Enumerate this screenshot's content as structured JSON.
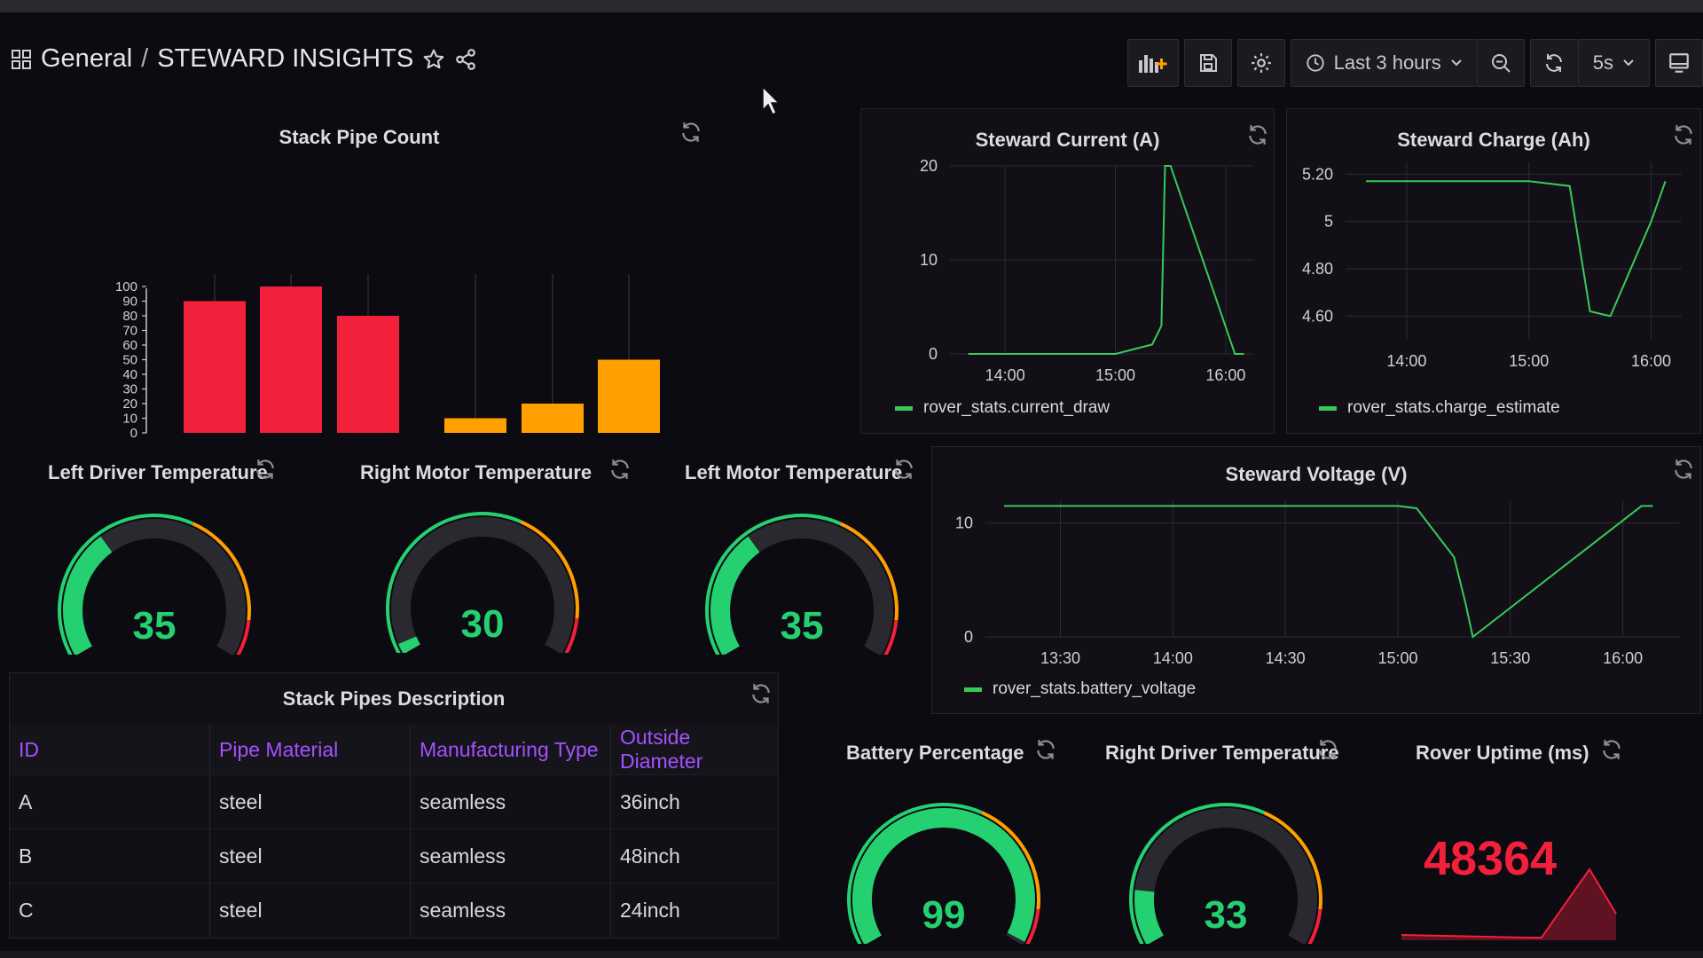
{
  "header": {
    "breadcrumb_root": "General",
    "breadcrumb_sep": "/",
    "dashboard_title": "STEWARD INSIGHTS",
    "time_range": "Last 3 hours",
    "refresh_interval": "5s"
  },
  "panels": {
    "stack_pipe_count": {
      "title": "Stack Pipe Count"
    },
    "steward_current": {
      "title": "Steward Current (A)",
      "legend": "rover_stats.current_draw"
    },
    "steward_charge": {
      "title": "Steward Charge (Ah)",
      "legend": "rover_stats.charge_estimate"
    },
    "steward_voltage": {
      "title": "Steward Voltage (V)",
      "legend": "rover_stats.battery_voltage"
    },
    "left_driver_temp": {
      "title": "Left Driver Temperature",
      "value": "35"
    },
    "right_motor_temp": {
      "title": "Right Motor Temperature",
      "value": "30"
    },
    "left_motor_temp": {
      "title": "Left Motor Temperature",
      "value": "35"
    },
    "battery_percentage": {
      "title": "Battery Percentage",
      "value": "99"
    },
    "right_driver_temp": {
      "title": "Right Driver Temperature",
      "value": "33"
    },
    "rover_uptime": {
      "title": "Rover Uptime (ms)",
      "value": "48364"
    },
    "stack_pipes_description": {
      "title": "Stack Pipes Description",
      "columns": [
        "ID",
        "Pipe Material",
        "Manufacturing Type",
        "Outside Diameter"
      ],
      "rows": [
        [
          "A",
          "steel",
          "seamless",
          "36inch"
        ],
        [
          "B",
          "steel",
          "seamless",
          "48inch"
        ],
        [
          "C",
          "steel",
          "seamless",
          "24inch"
        ]
      ]
    }
  },
  "colors": {
    "green": "#25d070",
    "red": "#f2203a",
    "orange": "#ff9f00",
    "purple": "#a352ff",
    "series_green": "#37c95a"
  },
  "chart_data": [
    {
      "type": "bar",
      "title": "Stack Pipe Count",
      "categories": [
        "",
        "",
        "",
        "",
        "",
        ""
      ],
      "values": [
        90,
        100,
        80,
        10,
        20,
        50
      ],
      "bar_colors": [
        "#f2203a",
        "#f2203a",
        "#f2203a",
        "#ff9f00",
        "#ff9f00",
        "#ff9f00"
      ],
      "ylim": [
        0,
        100
      ],
      "yticks": [
        0,
        10,
        20,
        30,
        40,
        50,
        60,
        70,
        80,
        90,
        100
      ]
    },
    {
      "type": "line",
      "title": "Steward Current (A)",
      "series": [
        {
          "name": "rover_stats.current_draw",
          "x": [
            "13:40",
            "14:30",
            "15:00",
            "15:20",
            "15:25",
            "15:27",
            "15:30",
            "16:05",
            "16:10"
          ],
          "values": [
            0,
            0,
            0,
            1,
            3,
            20,
            20,
            0,
            0
          ]
        }
      ],
      "xticks": [
        "14:00",
        "15:00",
        "16:00"
      ],
      "yticks": [
        0,
        10,
        20
      ],
      "ylim": [
        0,
        20
      ]
    },
    {
      "type": "line",
      "title": "Steward Charge (Ah)",
      "series": [
        {
          "name": "rover_stats.charge_estimate",
          "x": [
            "13:40",
            "14:00",
            "15:00",
            "15:20",
            "15:30",
            "15:40",
            "16:00",
            "16:07"
          ],
          "values": [
            5.17,
            5.17,
            5.17,
            5.15,
            4.62,
            4.6,
            5.0,
            5.17
          ]
        }
      ],
      "xticks": [
        "14:00",
        "15:00",
        "16:00"
      ],
      "yticks": [
        4.6,
        4.8,
        5,
        5.2
      ],
      "ytick_labels": [
        "4.60",
        "4.80",
        "5",
        "5.20"
      ],
      "ylim": [
        4.5,
        5.25
      ]
    },
    {
      "type": "line",
      "title": "Steward Voltage (V)",
      "series": [
        {
          "name": "rover_stats.battery_voltage",
          "x": [
            "13:15",
            "15:00",
            "15:05",
            "15:15",
            "15:18",
            "15:20",
            "16:05",
            "16:08"
          ],
          "values": [
            11.5,
            11.5,
            11.3,
            7,
            3,
            0,
            11.5,
            11.5
          ]
        }
      ],
      "xticks": [
        "13:30",
        "14:00",
        "14:30",
        "15:00",
        "15:30",
        "16:00"
      ],
      "yticks": [
        0,
        10
      ],
      "ylim": [
        0,
        12
      ]
    }
  ]
}
